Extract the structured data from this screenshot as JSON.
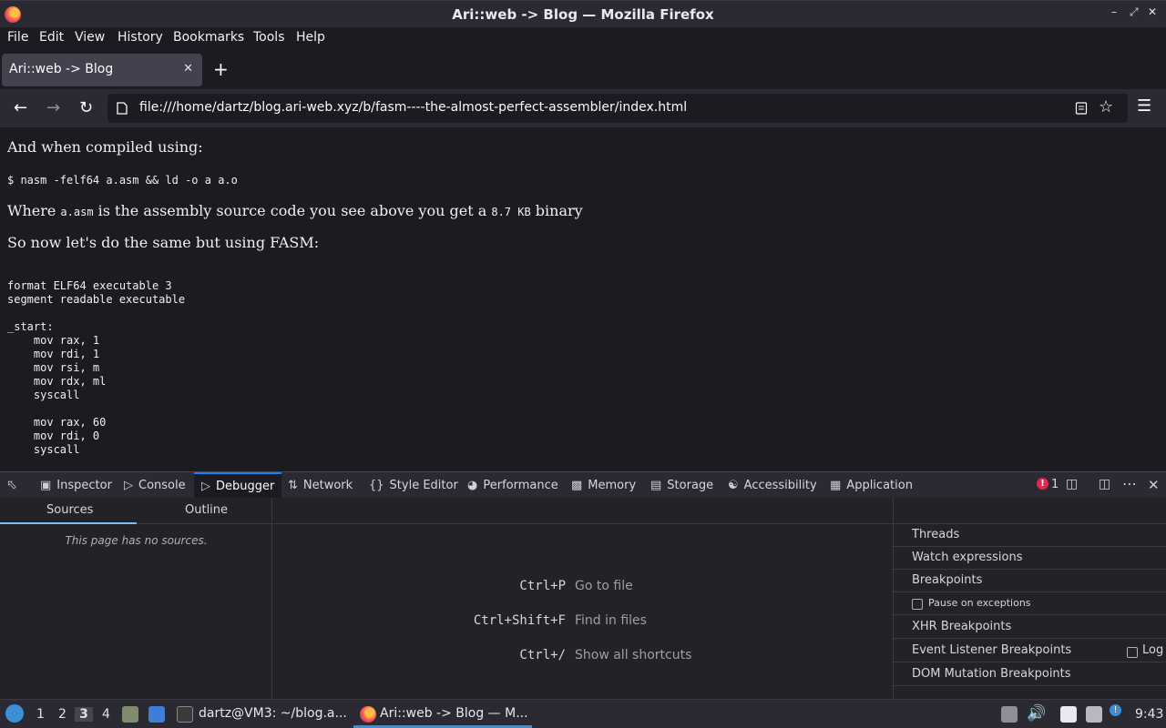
{
  "window": {
    "title": "Ari::web -> Blog — Mozilla Firefox",
    "controls": [
      "–",
      "⤢",
      "✕"
    ]
  },
  "menubar": [
    "File",
    "Edit",
    "View",
    "History",
    "Bookmarks",
    "Tools",
    "Help"
  ],
  "tab": {
    "label": "Ari::web -> Blog",
    "close": "✕",
    "new_tab": "+"
  },
  "navbar": {
    "url": "file:///home/dartz/blog.ari-web.xyz/b/fasm----the-almost-perfect-assembler/index.html"
  },
  "content": {
    "p1": "And when compiled using:",
    "cmd": "$ nasm -felf64 a.asm && ld -o a a.o",
    "p2_a": "Where ",
    "p2_code1": "a.asm",
    "p2_b": " is the assembly source code you see above you get a ",
    "p2_code2": "8.7 KB",
    "p2_c": " binary",
    "p3": "So now let's do the same but using FASM:",
    "code": [
      "format ELF64 executable 3",
      "segment readable executable",
      "",
      "_start:",
      "    mov rax, 1",
      "    mov rdi, 1",
      "    mov rsi, m",
      "    mov rdx, ml",
      "    syscall",
      "",
      "    mov rax, 60",
      "    mov rdi, 0",
      "    syscall"
    ]
  },
  "devtools": {
    "tabs": [
      "Inspector",
      "Console",
      "Debugger",
      "Network",
      "Style Editor",
      "Performance",
      "Memory",
      "Storage",
      "Accessibility",
      "Application"
    ],
    "selected_tab": "Debugger",
    "error_count": "1",
    "left_tabs": [
      "Sources",
      "Outline"
    ],
    "no_sources": "This page has no sources.",
    "shortcuts": [
      {
        "key": "Ctrl+P",
        "desc": "Go to file"
      },
      {
        "key": "Ctrl+Shift+F",
        "desc": "Find in files"
      },
      {
        "key": "Ctrl+/",
        "desc": "Show all shortcuts"
      }
    ],
    "right_items": [
      "Threads",
      "Watch expressions",
      "Breakpoints"
    ],
    "pause_on_exceptions": "Pause on exceptions",
    "right_items2": [
      "XHR Breakpoints",
      "Event Listener Breakpoints",
      "DOM Mutation Breakpoints"
    ],
    "log_label": "Log"
  },
  "taskbar": {
    "workspaces": [
      "1",
      "2",
      "3",
      "4"
    ],
    "active_workspace": "3",
    "windows": [
      "dartz@VM3: ~/blog.a...",
      "Ari::web -> Blog — M..."
    ],
    "clock": "9:43"
  },
  "colors": {
    "accent": "#75bfff",
    "error": "#e22850",
    "active_underline": "#0a84ff"
  }
}
